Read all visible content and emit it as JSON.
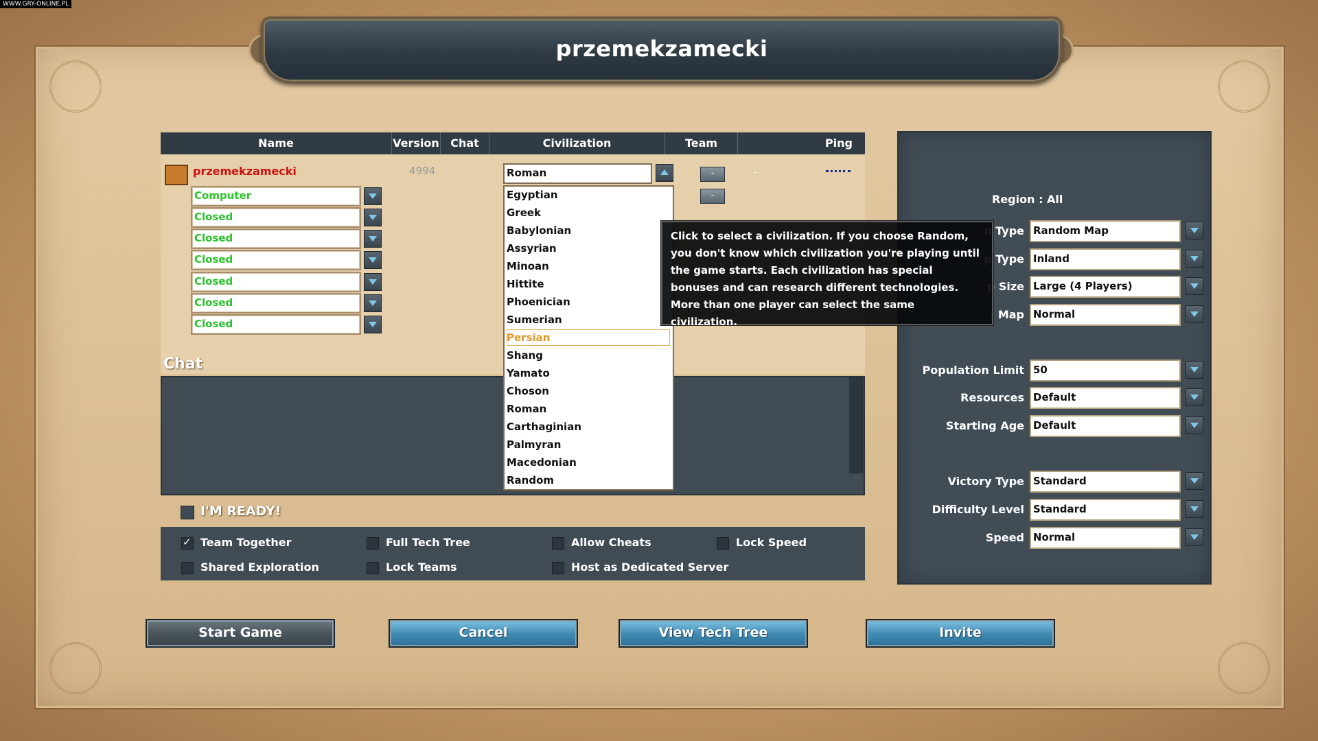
{
  "watermark": "WWW.GRY-ONLINE.PL",
  "title": "przemekzamecki",
  "players_table": {
    "columns": [
      "Name",
      "Version",
      "Chat",
      "Civilization",
      "Team",
      "Ping"
    ],
    "host": {
      "name": "przemekzamecki",
      "version": "4994",
      "civilization": "Roman",
      "team": "-",
      "team_col_value": "-"
    },
    "slots": [
      "Computer",
      "Closed",
      "Closed",
      "Closed",
      "Closed",
      "Closed",
      "Closed"
    ],
    "computer_team": "-"
  },
  "civ_dropdown": {
    "options": [
      "Egyptian",
      "Greek",
      "Babylonian",
      "Assyrian",
      "Minoan",
      "Hittite",
      "Phoenician",
      "Sumerian",
      "Persian",
      "Shang",
      "Yamato",
      "Choson",
      "Roman",
      "Carthaginian",
      "Palmyran",
      "Macedonian",
      "Random"
    ],
    "highlighted": "Persian"
  },
  "tooltip": "Click to select a civilization. If you choose Random, you don't know which civilization you're playing until the game starts. Each civilization has special bonuses and can research different technologies. More than one player can select the same civilization.",
  "chat": {
    "label": "Chat"
  },
  "ready": {
    "label": "I'M READY!"
  },
  "options": [
    {
      "label": "Team Together",
      "checked": true
    },
    {
      "label": "Full Tech Tree",
      "checked": false
    },
    {
      "label": "Allow Cheats",
      "checked": false
    },
    {
      "label": "Lock Speed",
      "checked": false
    },
    {
      "label": "Shared Exploration",
      "checked": false
    },
    {
      "label": "Lock Teams",
      "checked": false
    },
    {
      "label": "Host as Dedicated Server",
      "checked": false
    }
  ],
  "settings": {
    "region": "Region : All",
    "rows": [
      {
        "label": "n Type",
        "value": "Random Map"
      },
      {
        "label": "p Type",
        "value": "Inland"
      },
      {
        "label": "p Size",
        "value": "Large (4 Players)"
      },
      {
        "label": "l Map",
        "value": "Normal"
      },
      {
        "label": "Population Limit",
        "value": "50"
      },
      {
        "label": "Resources",
        "value": "Default"
      },
      {
        "label": "Starting Age",
        "value": "Default"
      },
      {
        "label": "Victory Type",
        "value": "Standard"
      },
      {
        "label": "Difficulty Level",
        "value": "Standard"
      },
      {
        "label": "Speed",
        "value": "Normal"
      }
    ]
  },
  "buttons": {
    "start": "Start Game",
    "cancel": "Cancel",
    "tech_tree": "View Tech Tree",
    "invite": "Invite"
  },
  "colors": {
    "slot_text": "#2bc42b",
    "host_name": "#cc1111",
    "highlight": "#e09a28",
    "panel": "#414c55"
  }
}
